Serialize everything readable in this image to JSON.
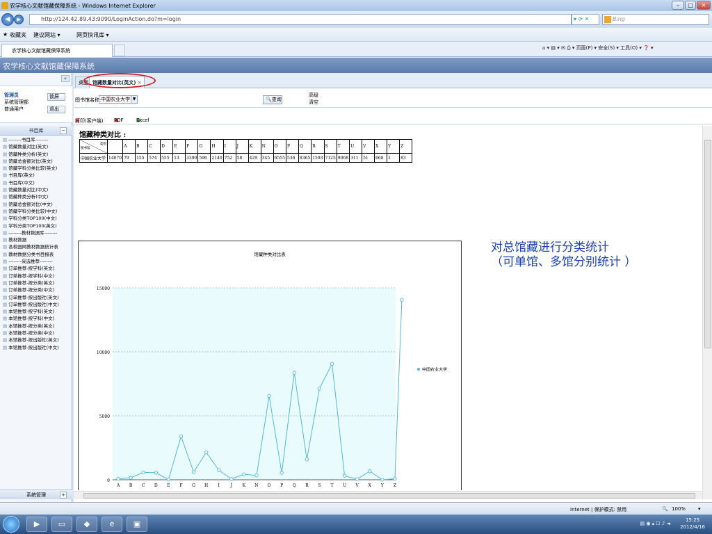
{
  "window": {
    "title": "农学核心文献馆藏保障系统 - Windows Internet Explorer",
    "min": "–",
    "max": "□",
    "close": "×"
  },
  "address": {
    "url": "http://124.42.89.43:9090/LoginAction.do?m=login",
    "search_placeholder": "Bing",
    "nav_icons": "▾ ⟳ ✕"
  },
  "favorites": {
    "fav": "收藏夹",
    "suggest": "建议网站 ▾",
    "gallery": "网页快讯库 ▾"
  },
  "browser_tab": {
    "label": "农学核心文献馆藏保障系统",
    "commands": "⌂ ▾  ▤ ▾  ✉  ⎙ ▾  页面(P) ▾  安全(S) ▾  工具(O) ▾  ❓ ▾"
  },
  "app": {
    "title": "农学核心文献馆藏保障系统"
  },
  "sidebar": {
    "collapse": "«",
    "user_lines": [
      "管理员",
      "系统管理部",
      "普通用户"
    ],
    "btn_lock": "锁屏",
    "btn_exit": "退出",
    "section": "书目库",
    "section_toggle": "−",
    "items": [
      "--------书目库--------",
      "馆藏数量对比(英文)",
      "馆藏种类分析(英文)",
      "馆藏总金额对比(英文)",
      "馆藏学科分类比较(英文)",
      "书目库(英文)",
      "书目库(中文)",
      "馆藏数量对比(中文)",
      "馆藏种类分析(中文)",
      "馆藏总金额对比(中文)",
      "馆藏学科分类比较(中文)",
      "学科分类TOP100(中文)",
      "学科分类TOP100(英文)",
      "--------教材数据库--------",
      "教材数据",
      "各校园网教材数据统计表",
      "教材数据分类书目报表",
      "--------采选推荐--------",
      "订单推荐-按学科(英文)",
      "订单推荐-按学科(中文)",
      "订单推荐-按分类(英文)",
      "订单推荐-按分类(中文)",
      "订单推荐-按出版社(英文)",
      "订单推荐-按出版社(中文)",
      "本馆推荐-按学科(英文)",
      "本馆推荐-按学科(中文)",
      "本馆推荐-按分类(英文)",
      "本馆推荐-按分类(中文)",
      "本馆推荐-按出版社(英文)",
      "本馆推荐-按出版社(中文)"
    ],
    "system": "系统管理",
    "system_toggle": "+"
  },
  "main": {
    "tab_home": "桌面",
    "tab_active": "馆藏数量对比(英文)",
    "tab_close": "×",
    "filter_label": "图书馆名称:",
    "filter_value": "中国农业大学",
    "query_btn": "查询",
    "opt1": "高级",
    "opt2": "清空",
    "export_print": "打印(客户端)",
    "export_pdf": "PDF",
    "export_excel": "Excel",
    "report_title": "馆藏种类对比 :",
    "table_corner_top": "类别",
    "table_corner_bottom": "图书馆",
    "annotation_line1": "对总馆藏进行分类统计",
    "annotation_line2": "（可单馆、多馆分别统计 ）"
  },
  "chart_data": {
    "type": "line",
    "title": "馆藏种类对比表",
    "categories": [
      "A",
      "B",
      "C",
      "D",
      "E",
      "F",
      "G",
      "H",
      "I",
      "J",
      "K",
      "N",
      "O",
      "P",
      "Q",
      "R",
      "S",
      "T",
      "U",
      "V",
      "X",
      "Y",
      "Z"
    ],
    "series": [
      {
        "name": "中国农业大学",
        "values": [
          79,
          155,
          574,
          555,
          13,
          3390,
          596,
          2140,
          752,
          58,
          429,
          345,
          6555,
          536,
          8365,
          1593,
          7125,
          9068,
          311,
          51,
          668,
          1,
          83
        ]
      }
    ],
    "first_value": 14070,
    "ylim": [
      0,
      15000
    ],
    "yticks": [
      0,
      5000,
      10000,
      15000
    ],
    "legend_position": "right",
    "grid": true,
    "color": "#4fb8de",
    "plot_bg": "#e9fbfd"
  },
  "status": {
    "zone": "Internet | 保护模式: 禁用",
    "zoom": "100%",
    "arrow": "▾",
    "zoom_icon": "🔍"
  },
  "taskbar": {
    "time": "15:25",
    "date": "2012/4/16",
    "tray": "▤ ◉ ▴ ☐ ♪ ◄"
  }
}
